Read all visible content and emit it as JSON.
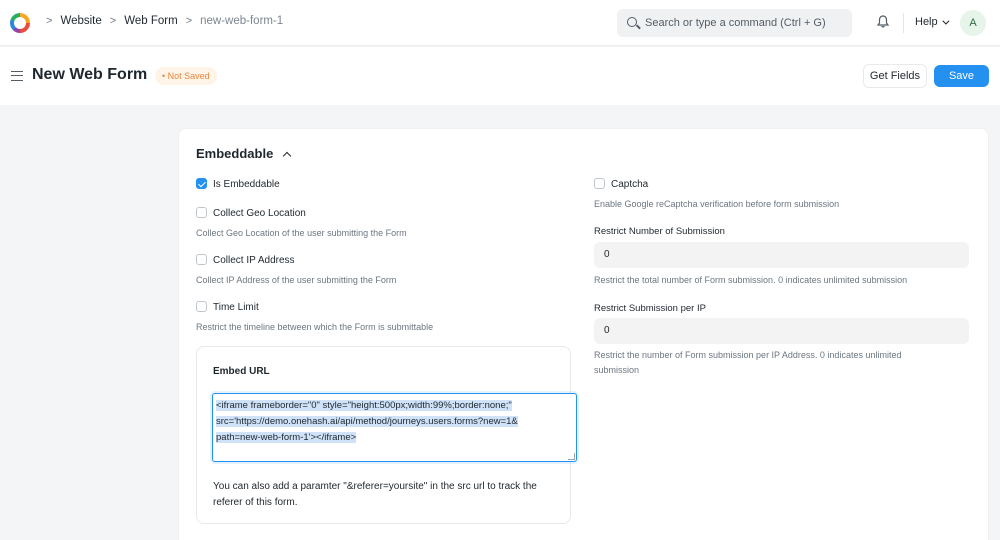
{
  "breadcrumbs": [
    "Website",
    "Web Form",
    "new-web-form-1"
  ],
  "search": {
    "placeholder": "Search or type a command (Ctrl + G)"
  },
  "help_label": "Help",
  "avatar_initial": "A",
  "page": {
    "title": "New Web Form",
    "status": "• Not Saved",
    "get_fields_label": "Get Fields",
    "save_label": "Save"
  },
  "section": {
    "title": "Embeddable",
    "left": {
      "is_embeddable": {
        "label": "Is Embeddable",
        "checked": true
      },
      "collect_geo": {
        "label": "Collect Geo Location",
        "desc": "Collect Geo Location of the user submitting the Form",
        "checked": false
      },
      "collect_ip": {
        "label": "Collect IP Address",
        "desc": "Collect IP Address of the user submitting the Form",
        "checked": false
      },
      "time_limit": {
        "label": "Time Limit",
        "desc": "Restrict the timeline between which the Form is submittable",
        "checked": false
      }
    },
    "right": {
      "captcha": {
        "label": "Captcha",
        "desc": "Enable Google reCaptcha verification before form submission",
        "checked": false
      },
      "restrict_submission": {
        "label": "Restrict Number of Submission",
        "value": "0",
        "desc": "Restrict the total number of Form submission. 0 indicates unlimited submission"
      },
      "restrict_per_ip": {
        "label": "Restrict Submission per IP",
        "value": "0",
        "desc1": "Restrict the number of Form submission per IP Address. 0 indicates unlimited",
        "desc2": "submission"
      }
    },
    "embed": {
      "label": "Embed URL",
      "code_line1": "<iframe frameborder=\"0\" style=\"height:500px;width:99%;border:none;\"",
      "code_line2": "src='https://demo.onehash.ai/api/method/journeys.users.forms?new=1&",
      "code_line3": "path=new-web-form-1'></iframe>",
      "note": "You can also add a paramter \"&referer=yoursite\" in the src url to track the referer of this form."
    }
  }
}
